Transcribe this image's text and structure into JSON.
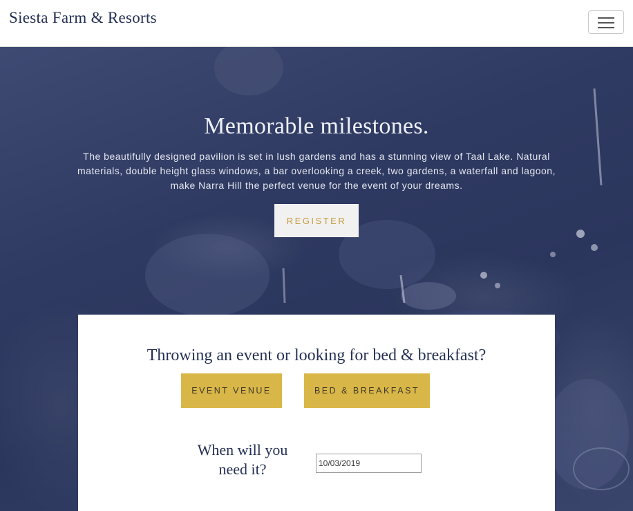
{
  "navbar": {
    "brand": "Siesta Farm & Resorts",
    "menu_icon": "hamburger-menu-icon"
  },
  "hero": {
    "title": "Memorable milestones.",
    "description": "The beautifully designed pavilion is set in lush gardens and has a stunning view of Taal Lake. Natural materials, double height glass windows, a bar overlooking a creek, two gardens, a waterfall and lagoon, make Narra Hill the perfect venue for the event of your dreams.",
    "register_label": "REGISTER"
  },
  "booking": {
    "title": "Throwing an event or looking for bed & breakfast?",
    "event_venue_label": "EVENT VENUE",
    "bed_breakfast_label": "BED & BREAKFAST",
    "when_label": "When will you need it?",
    "date_value": "10/03/2019"
  },
  "colors": {
    "brand": "#243054",
    "hero_overlay": "#2f3a62",
    "accent_gold": "#d9b648",
    "register_text": "#c69c3c"
  }
}
